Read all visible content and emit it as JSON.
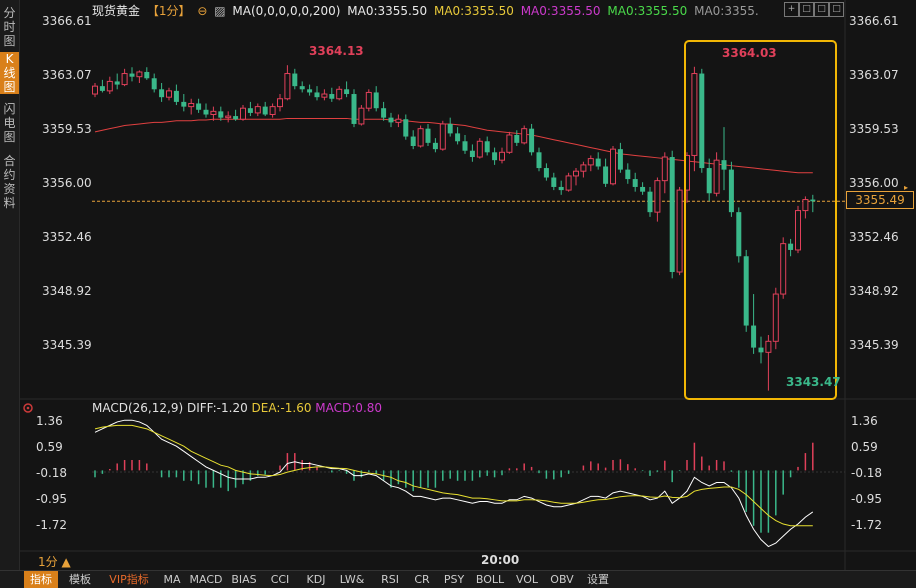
{
  "sidebar": {
    "tabs": [
      {
        "label": "分时图",
        "active": false
      },
      {
        "label": "K线图",
        "active": true
      },
      {
        "label": "闪电图",
        "active": false
      },
      {
        "label": "合约资料",
        "active": false
      }
    ]
  },
  "header": {
    "title": "现货黄金",
    "period": "【1分】",
    "ma_settings": "MA(0,0,0,0,0,200)",
    "ma0": "MA0:3355.50",
    "ma1": "MA0:3355.50",
    "ma2": "MA0:3355.50",
    "ma3": "MA0:3355.50",
    "ma4": "MA0:3355."
  },
  "window_buttons": [
    "+",
    "□",
    "□",
    "□",
    "✕"
  ],
  "price_axis": {
    "labels": [
      "3366.61",
      "3363.07",
      "3359.53",
      "3356.00",
      "3352.46",
      "3348.92",
      "3345.39"
    ],
    "current_price": "3355.49"
  },
  "annotations": {
    "high1": "3364.13",
    "high2": "3364.03",
    "low": "3343.47"
  },
  "macd": {
    "title": "MACD(26,12,9)",
    "diff": "DIFF:-1.20",
    "dea": "DEA:-1.60",
    "macd": "MACD:0.80",
    "axis_labels": [
      "1.36",
      "0.59",
      "-0.18",
      "-0.95",
      "-1.72"
    ]
  },
  "time_axis": {
    "label": "20:00",
    "period_selector": "1分 ▲"
  },
  "bottom_tabs": [
    {
      "label": "指标",
      "active": true
    },
    {
      "label": "模板"
    },
    {
      "label": "VIP指标",
      "vip": true
    },
    {
      "label": "MA"
    },
    {
      "label": "MACD"
    },
    {
      "label": "BIAS"
    },
    {
      "label": "CCI"
    },
    {
      "label": "KDJ"
    },
    {
      "label": "LW&"
    },
    {
      "label": "RSI"
    },
    {
      "label": "CR"
    },
    {
      "label": "PSY"
    },
    {
      "label": "BOLL"
    },
    {
      "label": "VOL"
    },
    {
      "label": "OBV"
    },
    {
      "label": "设置"
    }
  ],
  "colors": {
    "up": "#e0405a",
    "down": "#3ab88a",
    "ma200": "#e04040",
    "highlight": "#f2b705",
    "dif": "#ffffff",
    "dea": "#e8e030"
  },
  "chart_data": {
    "type": "candlestick",
    "price_range": [
      3343.0,
      3367.0
    ],
    "candles": [
      [
        3362.3,
        3363.0,
        3362.1,
        3362.8
      ],
      [
        3362.8,
        3363.2,
        3362.4,
        3362.5
      ],
      [
        3362.5,
        3363.4,
        3362.3,
        3363.1
      ],
      [
        3363.1,
        3363.6,
        3362.6,
        3362.9
      ],
      [
        3362.9,
        3363.9,
        3362.8,
        3363.6
      ],
      [
        3363.6,
        3364.0,
        3363.1,
        3363.4
      ],
      [
        3363.4,
        3363.8,
        3363.0,
        3363.7
      ],
      [
        3363.7,
        3364.0,
        3363.2,
        3363.3
      ],
      [
        3363.3,
        3363.6,
        3362.4,
        3362.6
      ],
      [
        3362.6,
        3363.0,
        3361.8,
        3362.1
      ],
      [
        3362.1,
        3362.7,
        3361.9,
        3362.5
      ],
      [
        3362.5,
        3362.9,
        3361.6,
        3361.8
      ],
      [
        3361.8,
        3362.3,
        3361.2,
        3361.5
      ],
      [
        3361.5,
        3362.0,
        3361.0,
        3361.7
      ],
      [
        3361.7,
        3362.0,
        3361.1,
        3361.3
      ],
      [
        3361.3,
        3361.7,
        3360.8,
        3361.0
      ],
      [
        3361.0,
        3361.5,
        3360.6,
        3361.2
      ],
      [
        3361.2,
        3361.5,
        3360.6,
        3360.8
      ],
      [
        3360.8,
        3361.2,
        3360.5,
        3360.9
      ],
      [
        3360.9,
        3361.3,
        3360.6,
        3360.7
      ],
      [
        3360.7,
        3361.6,
        3360.6,
        3361.4
      ],
      [
        3361.4,
        3361.8,
        3360.9,
        3361.1
      ],
      [
        3361.1,
        3361.7,
        3360.9,
        3361.5
      ],
      [
        3361.5,
        3361.8,
        3360.9,
        3361.0
      ],
      [
        3361.0,
        3361.7,
        3360.8,
        3361.5
      ],
      [
        3361.5,
        3362.3,
        3361.2,
        3362.0
      ],
      [
        3362.0,
        3364.13,
        3361.9,
        3363.6
      ],
      [
        3363.6,
        3363.9,
        3362.6,
        3362.8
      ],
      [
        3362.8,
        3363.1,
        3362.4,
        3362.6
      ],
      [
        3362.6,
        3362.9,
        3362.2,
        3362.4
      ],
      [
        3362.4,
        3362.8,
        3361.9,
        3362.1
      ],
      [
        3362.1,
        3362.6,
        3361.9,
        3362.3
      ],
      [
        3362.3,
        3362.7,
        3361.8,
        3362.0
      ],
      [
        3362.0,
        3362.8,
        3361.9,
        3362.6
      ],
      [
        3362.6,
        3363.1,
        3362.1,
        3362.3
      ],
      [
        3362.3,
        3362.6,
        3360.2,
        3360.4
      ],
      [
        3360.4,
        3361.6,
        3360.3,
        3361.4
      ],
      [
        3361.4,
        3362.6,
        3361.2,
        3362.4
      ],
      [
        3362.4,
        3362.8,
        3361.2,
        3361.4
      ],
      [
        3361.4,
        3361.8,
        3360.6,
        3360.8
      ],
      [
        3360.8,
        3361.1,
        3360.2,
        3360.5
      ],
      [
        3360.5,
        3361.0,
        3360.2,
        3360.7
      ],
      [
        3360.7,
        3361.0,
        3359.4,
        3359.6
      ],
      [
        3359.6,
        3360.0,
        3358.8,
        3359.0
      ],
      [
        3359.0,
        3360.3,
        3358.9,
        3360.1
      ],
      [
        3360.1,
        3360.4,
        3359.0,
        3359.2
      ],
      [
        3359.2,
        3359.5,
        3358.6,
        3358.8
      ],
      [
        3358.8,
        3360.6,
        3358.7,
        3360.4
      ],
      [
        3360.4,
        3360.8,
        3359.6,
        3359.8
      ],
      [
        3359.8,
        3360.2,
        3359.1,
        3359.3
      ],
      [
        3359.3,
        3359.7,
        3358.5,
        3358.7
      ],
      [
        3358.7,
        3359.1,
        3358.0,
        3358.3
      ],
      [
        3358.3,
        3359.5,
        3358.2,
        3359.3
      ],
      [
        3359.3,
        3359.6,
        3358.4,
        3358.6
      ],
      [
        3358.6,
        3358.9,
        3357.8,
        3358.1
      ],
      [
        3358.1,
        3358.9,
        3357.9,
        3358.6
      ],
      [
        3358.6,
        3359.9,
        3358.5,
        3359.7
      ],
      [
        3359.7,
        3360.0,
        3359.0,
        3359.2
      ],
      [
        3359.2,
        3360.3,
        3359.1,
        3360.1
      ],
      [
        3360.1,
        3360.4,
        3358.4,
        3358.6
      ],
      [
        3358.6,
        3358.9,
        3357.4,
        3357.6
      ],
      [
        3357.6,
        3357.9,
        3356.8,
        3357.0
      ],
      [
        3357.0,
        3357.3,
        3356.2,
        3356.4
      ],
      [
        3356.4,
        3356.8,
        3355.9,
        3356.2
      ],
      [
        3356.2,
        3357.3,
        3356.1,
        3357.1
      ],
      [
        3357.1,
        3357.6,
        3356.5,
        3357.4
      ],
      [
        3357.4,
        3358.0,
        3357.0,
        3357.8
      ],
      [
        3357.8,
        3358.4,
        3357.4,
        3358.2
      ],
      [
        3358.2,
        3358.6,
        3357.5,
        3357.7
      ],
      [
        3357.7,
        3358.2,
        3356.4,
        3356.6
      ],
      [
        3356.6,
        3359.0,
        3356.5,
        3358.8
      ],
      [
        3358.8,
        3359.2,
        3357.3,
        3357.5
      ],
      [
        3357.5,
        3357.9,
        3356.6,
        3356.9
      ],
      [
        3356.9,
        3357.3,
        3356.1,
        3356.4
      ],
      [
        3356.4,
        3356.7,
        3355.9,
        3356.1
      ],
      [
        3356.1,
        3356.4,
        3354.5,
        3354.8
      ],
      [
        3354.8,
        3357.0,
        3354.2,
        3356.8
      ],
      [
        3356.8,
        3358.6,
        3356.0,
        3358.3
      ],
      [
        3358.3,
        3358.7,
        3350.6,
        3351.0
      ],
      [
        3351.0,
        3356.4,
        3350.8,
        3356.2
      ],
      [
        3356.2,
        3358.6,
        3355.4,
        3358.4
      ],
      [
        3358.4,
        3364.03,
        3357.4,
        3363.6
      ],
      [
        3363.6,
        3363.9,
        3357.3,
        3357.6
      ],
      [
        3357.6,
        3358.2,
        3355.5,
        3356.0
      ],
      [
        3356.0,
        3358.6,
        3355.8,
        3358.1
      ],
      [
        3358.1,
        3360.2,
        3356.2,
        3357.5
      ],
      [
        3357.5,
        3358.0,
        3354.5,
        3354.8
      ],
      [
        3354.8,
        3355.1,
        3351.6,
        3352.0
      ],
      [
        3352.0,
        3352.4,
        3347.2,
        3347.6
      ],
      [
        3347.6,
        3349.6,
        3345.8,
        3346.2
      ],
      [
        3346.2,
        3346.9,
        3345.2,
        3345.9
      ],
      [
        3345.9,
        3347.0,
        3343.47,
        3346.6
      ],
      [
        3346.6,
        3350.0,
        3346.1,
        3349.6
      ],
      [
        3349.6,
        3353.2,
        3349.3,
        3352.8
      ],
      [
        3352.8,
        3353.1,
        3352.0,
        3352.4
      ],
      [
        3352.4,
        3355.2,
        3352.2,
        3354.9
      ],
      [
        3354.9,
        3355.8,
        3354.4,
        3355.6
      ],
      [
        3355.6,
        3355.9,
        3354.8,
        3355.49
      ]
    ],
    "ma200": [
      3359.9,
      3360.0,
      3360.1,
      3360.2,
      3360.3,
      3360.35,
      3360.4,
      3360.45,
      3360.5,
      3360.5,
      3360.55,
      3360.6,
      3360.6,
      3360.6,
      3360.65,
      3360.65,
      3360.7,
      3360.7,
      3360.7,
      3360.7,
      3360.7,
      3360.7,
      3360.7,
      3360.7,
      3360.7,
      3360.7,
      3360.75,
      3360.75,
      3360.75,
      3360.75,
      3360.75,
      3360.75,
      3360.75,
      3360.75,
      3360.75,
      3360.7,
      3360.7,
      3360.7,
      3360.7,
      3360.7,
      3360.65,
      3360.6,
      3360.6,
      3360.55,
      3360.5,
      3360.5,
      3360.45,
      3360.4,
      3360.4,
      3360.35,
      3360.3,
      3360.2,
      3360.1,
      3360.0,
      3359.95,
      3359.9,
      3359.85,
      3359.8,
      3359.75,
      3359.7,
      3359.6,
      3359.5,
      3359.4,
      3359.3,
      3359.2,
      3359.1,
      3359.0,
      3358.9,
      3358.8,
      3358.7,
      3358.6,
      3358.5,
      3358.45,
      3358.4,
      3358.35,
      3358.3,
      3358.25,
      3358.2,
      3358.15,
      3358.1,
      3358.05,
      3358.0,
      3357.95,
      3357.9,
      3357.85,
      3357.8,
      3357.75,
      3357.7,
      3357.65,
      3357.6,
      3357.55,
      3357.5,
      3357.45,
      3357.4,
      3357.35,
      3357.3,
      3357.3,
      3357.3
    ],
    "macd_range": [
      -2.3,
      1.6
    ],
    "dif": [
      1.1,
      1.2,
      1.3,
      1.4,
      1.45,
      1.45,
      1.4,
      1.3,
      1.1,
      0.9,
      0.8,
      0.7,
      0.55,
      0.4,
      0.25,
      0.1,
      0.0,
      -0.1,
      -0.2,
      -0.25,
      -0.25,
      -0.25,
      -0.2,
      -0.2,
      -0.15,
      -0.05,
      0.2,
      0.25,
      0.2,
      0.2,
      0.15,
      0.1,
      0.05,
      0.05,
      0.0,
      -0.15,
      -0.15,
      -0.1,
      -0.15,
      -0.3,
      -0.45,
      -0.5,
      -0.6,
      -0.75,
      -0.75,
      -0.8,
      -0.85,
      -0.8,
      -0.8,
      -0.85,
      -0.9,
      -0.95,
      -0.9,
      -0.9,
      -0.95,
      -0.95,
      -0.85,
      -0.85,
      -0.75,
      -0.8,
      -0.9,
      -1.0,
      -1.05,
      -1.05,
      -1.0,
      -0.95,
      -0.85,
      -0.75,
      -0.75,
      -0.8,
      -0.65,
      -0.6,
      -0.65,
      -0.7,
      -0.75,
      -0.85,
      -0.8,
      -0.6,
      -0.95,
      -0.8,
      -0.6,
      -0.2,
      -0.35,
      -0.45,
      -0.35,
      -0.35,
      -0.5,
      -0.8,
      -1.3,
      -1.7,
      -2.0,
      -2.2,
      -2.1,
      -1.9,
      -1.7,
      -1.55,
      -1.35,
      -1.2
    ],
    "dea": [
      1.2,
      1.25,
      1.28,
      1.3,
      1.3,
      1.3,
      1.25,
      1.2,
      1.1,
      1.0,
      0.9,
      0.8,
      0.7,
      0.55,
      0.45,
      0.35,
      0.25,
      0.15,
      0.1,
      0.0,
      -0.05,
      -0.1,
      -0.12,
      -0.14,
      -0.15,
      -0.12,
      -0.05,
      0.0,
      0.05,
      0.08,
      0.1,
      0.1,
      0.08,
      0.06,
      0.05,
      0.0,
      -0.05,
      -0.08,
      -0.1,
      -0.15,
      -0.2,
      -0.3,
      -0.35,
      -0.45,
      -0.5,
      -0.55,
      -0.6,
      -0.65,
      -0.68,
      -0.7,
      -0.75,
      -0.8,
      -0.8,
      -0.82,
      -0.85,
      -0.88,
      -0.88,
      -0.88,
      -0.85,
      -0.85,
      -0.86,
      -0.88,
      -0.92,
      -0.95,
      -0.95,
      -0.95,
      -0.92,
      -0.88,
      -0.85,
      -0.84,
      -0.8,
      -0.76,
      -0.74,
      -0.73,
      -0.74,
      -0.77,
      -0.78,
      -0.74,
      -0.78,
      -0.79,
      -0.75,
      -0.6,
      -0.55,
      -0.52,
      -0.5,
      -0.48,
      -0.48,
      -0.55,
      -0.7,
      -0.9,
      -1.1,
      -1.3,
      -1.45,
      -1.55,
      -1.6,
      -1.6,
      -1.6,
      -1.6
    ]
  }
}
